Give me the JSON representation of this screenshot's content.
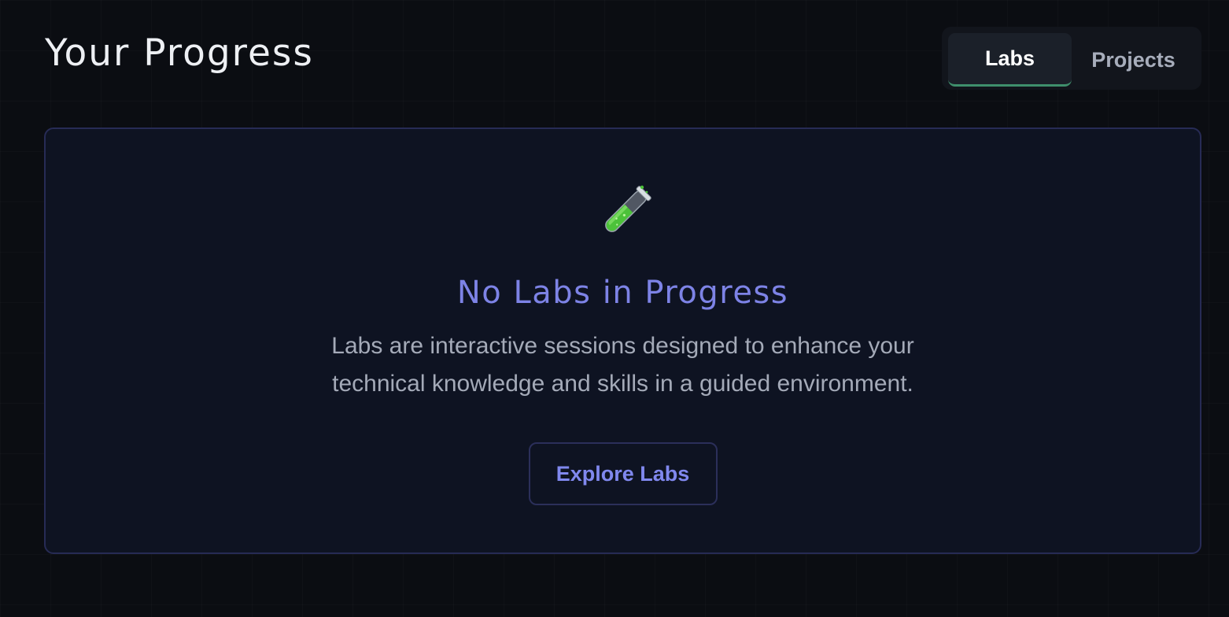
{
  "header": {
    "title": "Your Progress"
  },
  "tabs": [
    {
      "label": "Labs",
      "active": true
    },
    {
      "label": "Projects",
      "active": false
    }
  ],
  "empty_state": {
    "icon": "test-tube-icon",
    "title": "No Labs in Progress",
    "description": "Labs are interactive sessions designed to enhance your technical knowledge and skills in a guided environment.",
    "button_label": "Explore Labs"
  },
  "colors": {
    "background": "#0b0d12",
    "card_background": "#0e1322",
    "card_border": "#272b55",
    "accent": "#7d83e6",
    "active_tab_indicator": "#3f8f6c"
  }
}
